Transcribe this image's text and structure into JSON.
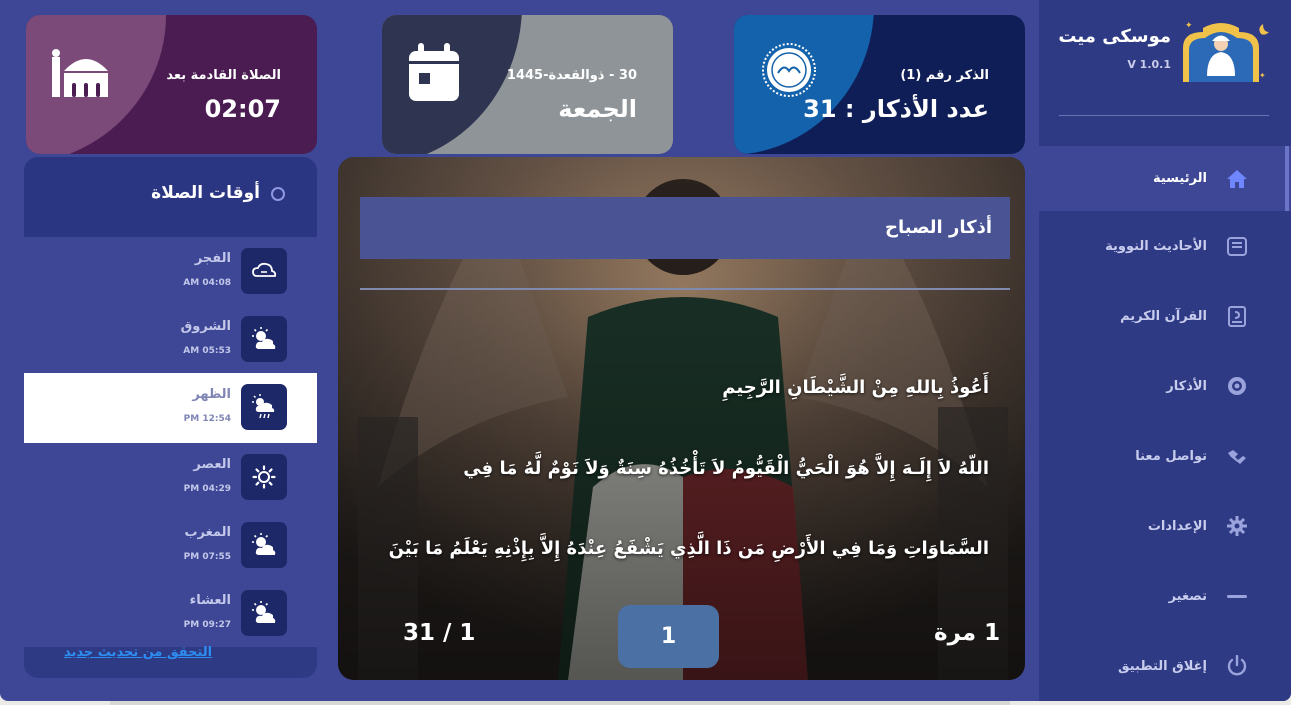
{
  "app": {
    "name": "موسكى ميت",
    "version": "V 1.0.1"
  },
  "nav": [
    {
      "label": "الرئيسية",
      "icon": "home-icon",
      "active": true
    },
    {
      "label": "الأحاديث النووية",
      "icon": "hadith-book-icon",
      "active": false
    },
    {
      "label": "القرآن الكريم",
      "icon": "quran-book-icon",
      "active": false
    },
    {
      "label": "الأذكار",
      "icon": "azkar-icon",
      "active": false
    },
    {
      "label": "تواصل معنا",
      "icon": "handshake-icon",
      "active": false
    },
    {
      "label": "الإعدادات",
      "icon": "gear-icon",
      "active": false
    },
    {
      "label": "تصغير",
      "icon": "minimize-icon",
      "active": false
    },
    {
      "label": "إغلاق التطبيق",
      "icon": "power-icon",
      "active": false
    }
  ],
  "cards": {
    "next_prayer": {
      "title": "الصلاة القادمة بعد",
      "value": "02:07",
      "icon": "mosque-icon"
    },
    "date": {
      "title": "30 - ذوالقعدة-1445",
      "value": "الجمعة",
      "icon": "calendar-icon"
    },
    "dhikr_count": {
      "title": "الذكر رقم (1)",
      "value": "عدد الأذكار : 31",
      "icon": "sunnah-seal-icon"
    }
  },
  "prayer_times": {
    "title": "أوقات الصلاة",
    "items": [
      {
        "name": "الفجر",
        "time": "AM 04:08",
        "icon": "cloud-moon-icon",
        "active": false
      },
      {
        "name": "الشروق",
        "time": "AM 05:53",
        "icon": "sun-cloud-icon",
        "active": false
      },
      {
        "name": "الظهر",
        "time": "PM 12:54",
        "icon": "sun-rain-icon",
        "active": true
      },
      {
        "name": "العصر",
        "time": "PM 04:29",
        "icon": "sun-icon",
        "active": false
      },
      {
        "name": "المغرب",
        "time": "PM 07:55",
        "icon": "sun-cloud-icon",
        "active": false
      },
      {
        "name": "العشاء",
        "time": "PM 09:27",
        "icon": "sun-cloud-icon",
        "active": false
      }
    ],
    "update_link": "التحقق من تحديث جديد"
  },
  "azkar": {
    "title": "أذكار الصباح",
    "lines": [
      "أَعُوذُ بِاللهِ مِنْ الشَّيْطَانِ الرَّجِيمِ",
      "اللّهُ لاَ إِلَـهَ إِلاَّ هُوَ الْحَيُّ الْقَيُّومُ لاَ تَأْخُذُهُ سِنَةٌ وَلاَ نَوْمٌ لَّهُ مَا فِي",
      "السَّمَاوَاتِ وَمَا فِي الأَرْضِ مَن ذَا الَّذِي يَشْفَعُ عِنْدَهُ إِلاَّ بِإِذْنِهِ يَعْلَمُ مَا بَيْنَ"
    ],
    "repeat": "1 مرة",
    "counter": "1",
    "progress": "31 / 1"
  },
  "colors": {
    "app_bg": "#3d4795",
    "sidebar_bg": "#2f3a84",
    "link": "#2d8ef2",
    "counter_btn": "#4a70a4"
  }
}
